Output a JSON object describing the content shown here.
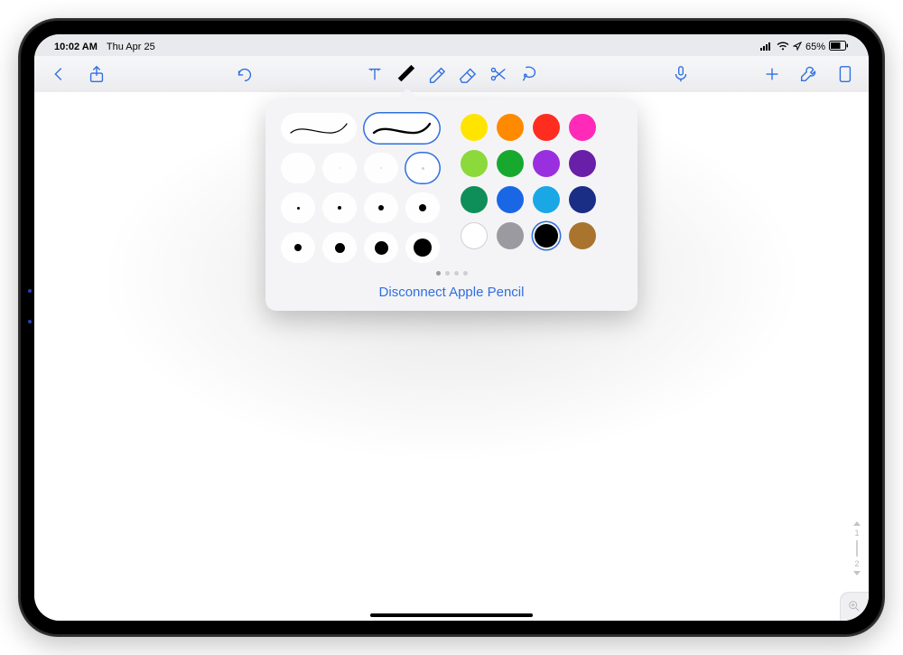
{
  "statusbar": {
    "time": "10:02 AM",
    "date": "Thu Apr 25",
    "battery": "65%"
  },
  "toolbar": {
    "tools": [
      "text",
      "pen",
      "highlighter",
      "eraser",
      "scissors",
      "lasso"
    ],
    "active_tool": "pen"
  },
  "popover": {
    "disconnect_label": "Disconnect Apple Pencil",
    "pager": {
      "count": 4,
      "active": 0
    },
    "strokes": [
      {
        "type": "curve",
        "weight": 1.2,
        "selected": false
      },
      {
        "type": "curve",
        "weight": 2.4,
        "selected": true
      }
    ],
    "tips": [
      {
        "size": 1,
        "opacity": 0.05,
        "selected": false
      },
      {
        "size": 2,
        "opacity": 0.08,
        "selected": false
      },
      {
        "size": 2,
        "opacity": 0.12,
        "selected": false
      },
      {
        "size": 3,
        "opacity": 0.18,
        "selected": true
      },
      {
        "size": 3,
        "opacity": 1.0,
        "selected": false
      },
      {
        "size": 4,
        "opacity": 1.0,
        "selected": false
      },
      {
        "size": 6,
        "opacity": 1.0,
        "selected": false
      },
      {
        "size": 8,
        "opacity": 1.0,
        "selected": false
      },
      {
        "size": 8,
        "opacity": 1.0,
        "selected": false
      },
      {
        "size": 11,
        "opacity": 1.0,
        "selected": false
      },
      {
        "size": 15,
        "opacity": 1.0,
        "selected": false
      },
      {
        "size": 20,
        "opacity": 1.0,
        "selected": false
      }
    ],
    "colors": [
      {
        "name": "yellow",
        "hex": "#ffe400",
        "selected": false
      },
      {
        "name": "orange",
        "hex": "#ff8a00",
        "selected": false
      },
      {
        "name": "red",
        "hex": "#ff2d1f",
        "selected": false
      },
      {
        "name": "magenta",
        "hex": "#ff2ab8",
        "selected": false
      },
      {
        "name": "lime",
        "hex": "#8bd93b",
        "selected": false
      },
      {
        "name": "green",
        "hex": "#17a82e",
        "selected": false
      },
      {
        "name": "violet",
        "hex": "#9a2fe0",
        "selected": false
      },
      {
        "name": "purple",
        "hex": "#6a1fa8",
        "selected": false
      },
      {
        "name": "teal",
        "hex": "#0e8f5a",
        "selected": false
      },
      {
        "name": "blue",
        "hex": "#1a67e6",
        "selected": false
      },
      {
        "name": "sky",
        "hex": "#1aa7e6",
        "selected": false
      },
      {
        "name": "navy",
        "hex": "#1a2e86",
        "selected": false
      },
      {
        "name": "white",
        "hex": "#ffffff",
        "selected": false
      },
      {
        "name": "gray",
        "hex": "#9a9aa0",
        "selected": false
      },
      {
        "name": "black",
        "hex": "#000000",
        "selected": true
      },
      {
        "name": "brown",
        "hex": "#a9742e",
        "selected": false
      }
    ]
  },
  "page_scrubber": {
    "current": "1",
    "total": "2"
  }
}
